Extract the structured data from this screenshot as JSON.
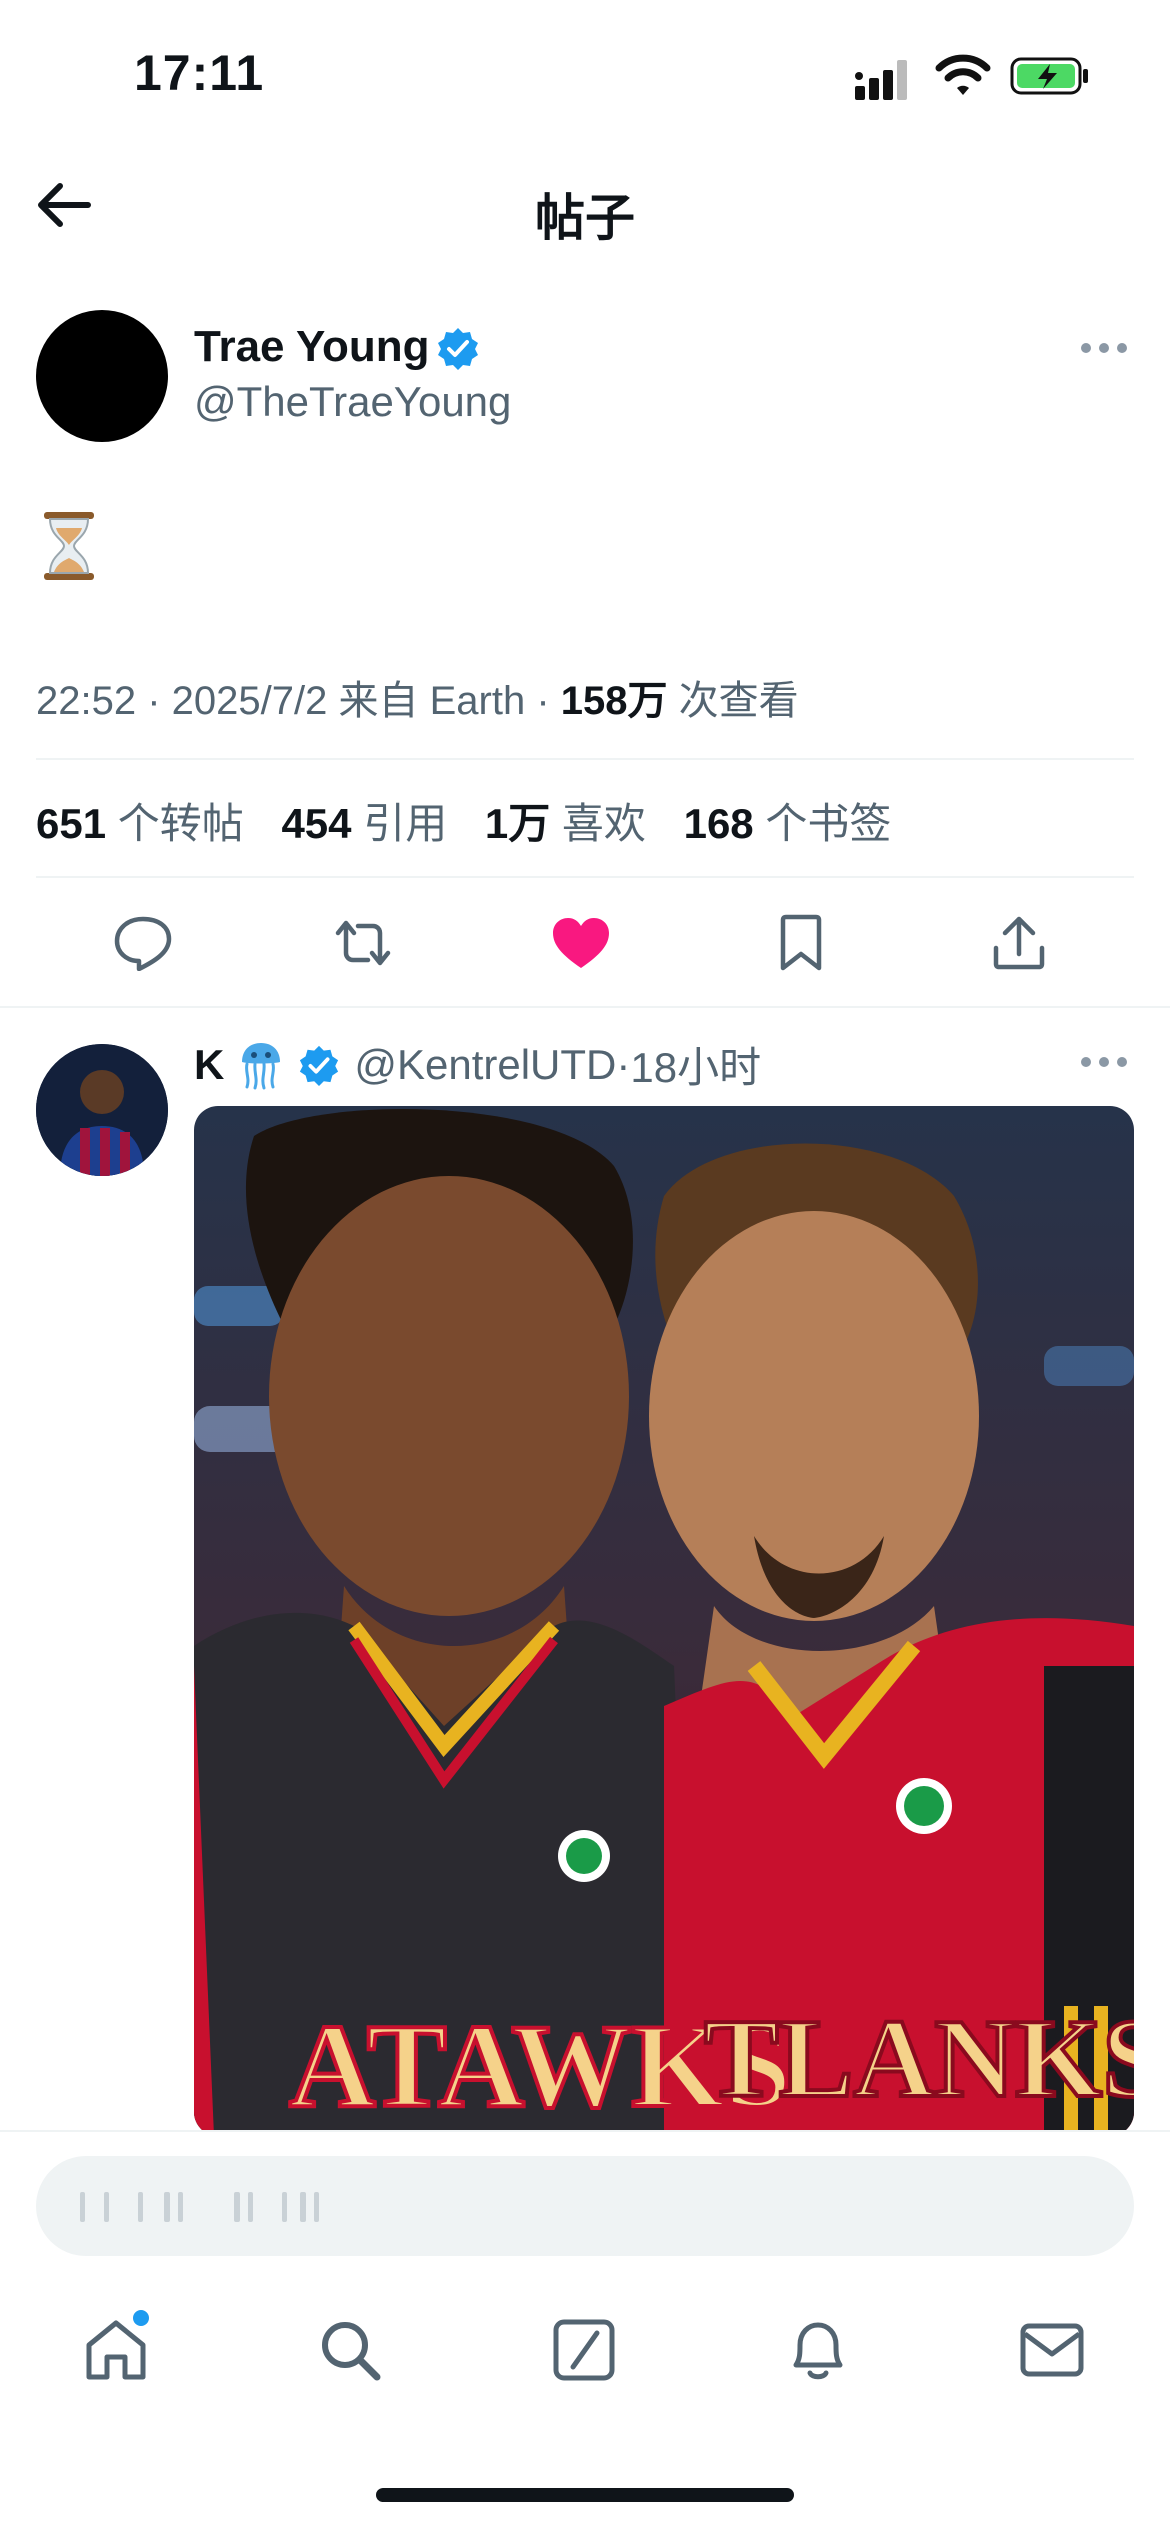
{
  "status_bar": {
    "time": "17:11"
  },
  "header": {
    "title": "帖子"
  },
  "post": {
    "author_name": "Trae Young",
    "author_handle": "@TheTraeYoung",
    "content_emoji": "⏳",
    "time": "22:52",
    "date": "2025/7/2",
    "source": "来自 Earth",
    "views_count": "158万",
    "views_label": "次查看"
  },
  "stats": {
    "reposts_count": "651",
    "reposts_label": "个转帖",
    "quotes_count": "454",
    "quotes_label": "引用",
    "likes_count": "1万",
    "likes_label": "喜欢",
    "bookmarks_count": "168",
    "bookmarks_label": "个书签"
  },
  "reply": {
    "author_name": "K",
    "author_handle": "@KentrelUTD",
    "time_ago": "18小时",
    "image_text_left": "ATAWKS",
    "image_text_right": "TLANKS"
  },
  "composer": {
    "placeholder": ""
  },
  "colors": {
    "accent": "#1d9bf0",
    "like": "#f91880",
    "secondary_text": "#536471",
    "battery": "#4cd964"
  },
  "icons": {
    "back": "arrow-left-icon",
    "verified": "verified-badge-icon",
    "more": "more-horizontal-icon",
    "reply": "reply-icon",
    "repost": "repost-icon",
    "like": "heart-icon",
    "bookmark": "bookmark-icon",
    "share": "share-icon",
    "home": "home-icon",
    "search": "search-icon",
    "grok": "grok-icon",
    "notifications": "bell-icon",
    "messages": "mail-icon"
  }
}
